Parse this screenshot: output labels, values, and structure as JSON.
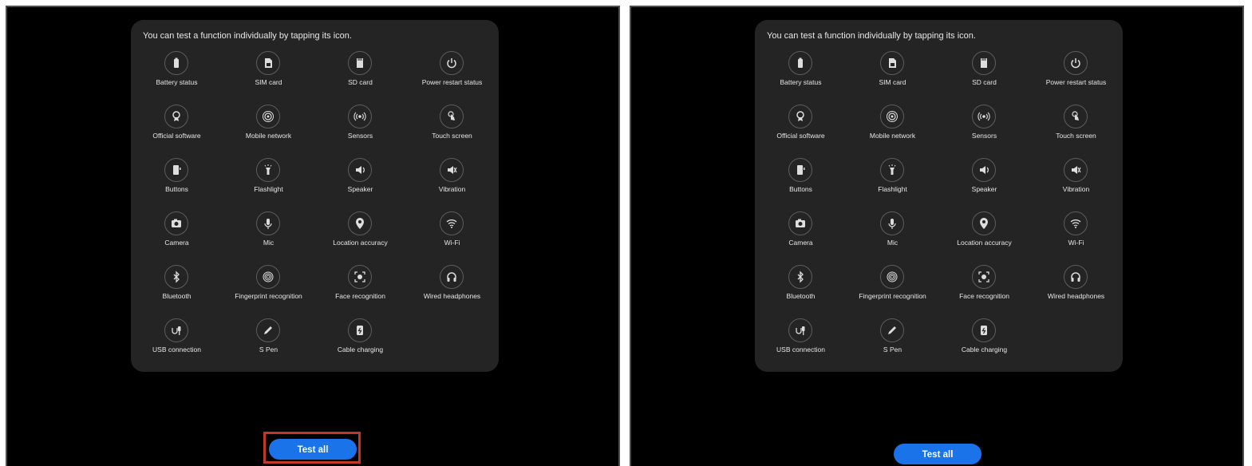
{
  "panel": {
    "hint_text": "You can test a function individually by tapping its icon.",
    "items": [
      {
        "label": "Battery status",
        "icon": "battery-icon"
      },
      {
        "label": "SIM card",
        "icon": "sim-card-icon"
      },
      {
        "label": "SD card",
        "icon": "sd-card-icon"
      },
      {
        "label": "Power restart status",
        "icon": "power-restart-icon"
      },
      {
        "label": "Official software",
        "icon": "official-software-icon"
      },
      {
        "label": "Mobile network",
        "icon": "mobile-network-icon"
      },
      {
        "label": "Sensors",
        "icon": "sensors-icon"
      },
      {
        "label": "Touch screen",
        "icon": "touch-screen-icon"
      },
      {
        "label": "Buttons",
        "icon": "buttons-icon"
      },
      {
        "label": "Flashlight",
        "icon": "flashlight-icon"
      },
      {
        "label": "Speaker",
        "icon": "speaker-icon"
      },
      {
        "label": "Vibration",
        "icon": "vibration-icon"
      },
      {
        "label": "Camera",
        "icon": "camera-icon"
      },
      {
        "label": "Mic",
        "icon": "mic-icon"
      },
      {
        "label": "Location accuracy",
        "icon": "location-icon"
      },
      {
        "label": "Wi-Fi",
        "icon": "wifi-icon"
      },
      {
        "label": "Bluetooth",
        "icon": "bluetooth-icon"
      },
      {
        "label": "Fingerprint recognition",
        "icon": "fingerprint-icon"
      },
      {
        "label": "Face recognition",
        "icon": "face-recognition-icon"
      },
      {
        "label": "Wired headphones",
        "icon": "headphones-icon"
      },
      {
        "label": "USB connection",
        "icon": "usb-connection-icon"
      },
      {
        "label": "S Pen",
        "icon": "s-pen-icon"
      },
      {
        "label": "Cable charging",
        "icon": "cable-charging-icon"
      }
    ]
  },
  "footer": {
    "test_all_label": "Test all"
  },
  "colors": {
    "accent": "#1a73e8",
    "highlight": "#c0392b",
    "panel_bg": "#242424"
  }
}
